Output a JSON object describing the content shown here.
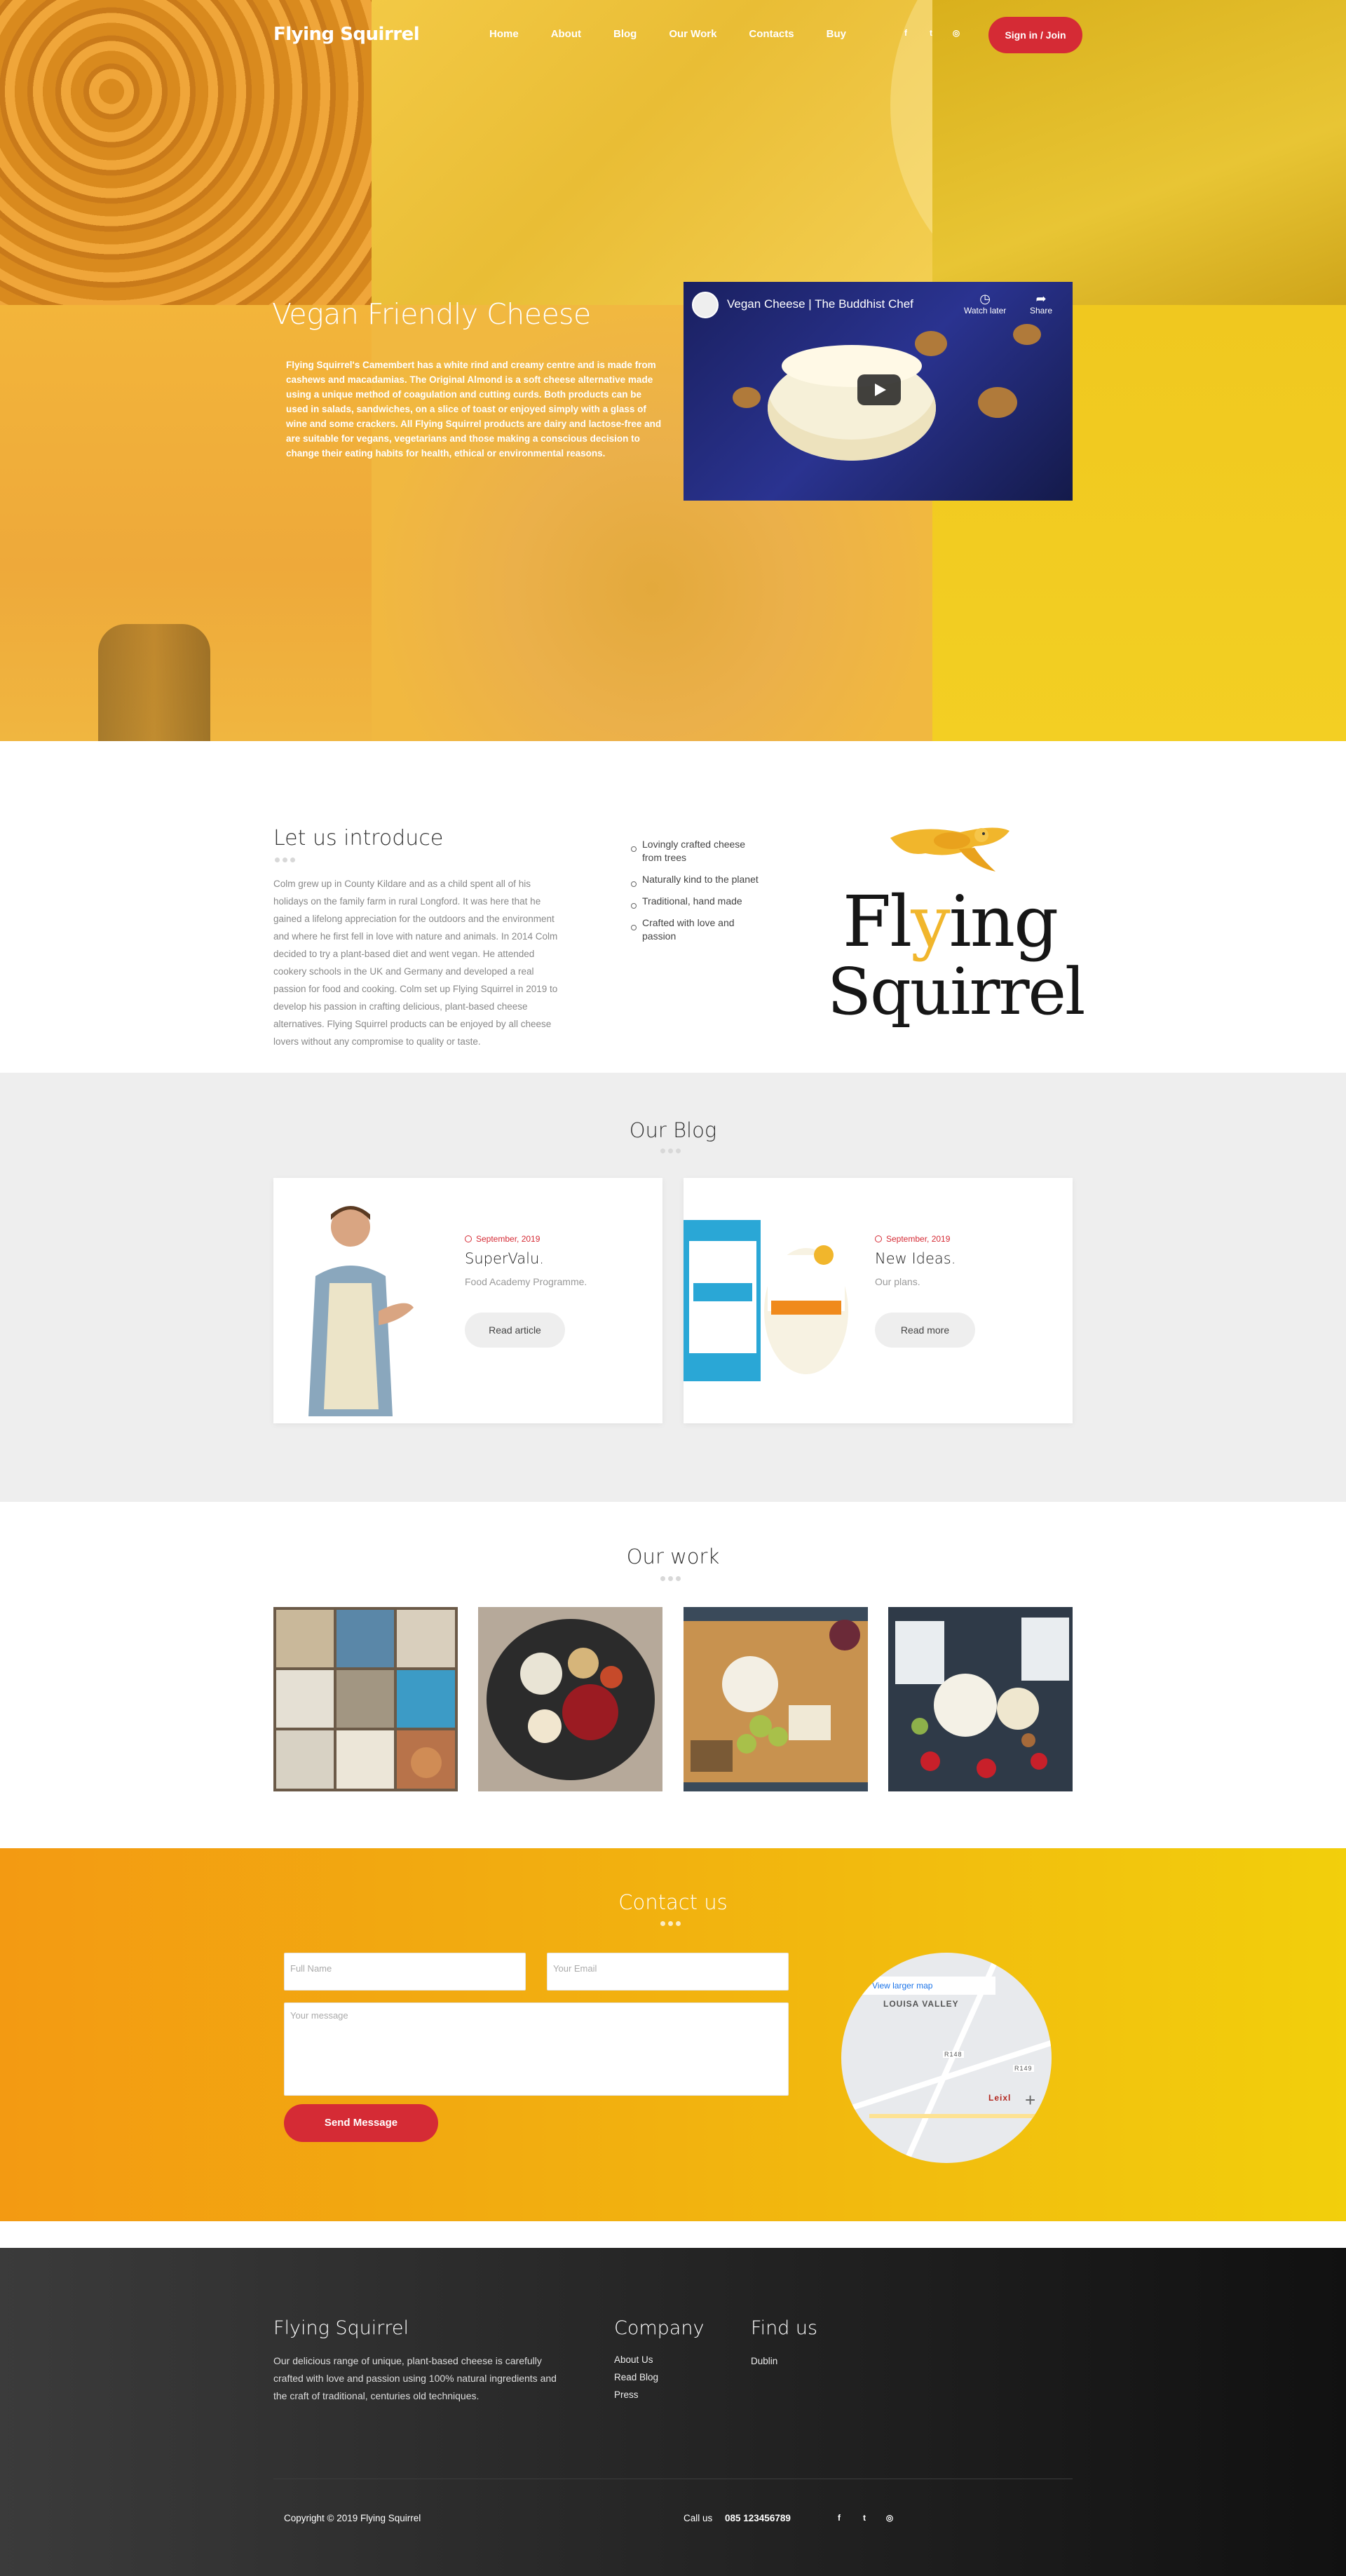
{
  "nav": {
    "brand": "Flying Squirrel",
    "menu": [
      "Home",
      "About",
      "Blog",
      "Our Work",
      "Contacts",
      "Buy"
    ],
    "social_icons": [
      "facebook-icon",
      "twitter-icon",
      "instagram-icon"
    ],
    "signin_label": "Sign in / Join"
  },
  "hero": {
    "title": "Vegan Friendly Cheese",
    "text": "Flying Squirrel's Camembert has a white rind and creamy centre and is made from cashews and macadamias. The Original Almond is a soft cheese alternative made using a unique method of coagulation and cutting curds. Both products can be used in salads, sandwiches, on a slice of toast or enjoyed simply with a glass of wine and some crackers. All Flying Squirrel products are dairy and lactose-free and are suitable for vegans, vegetarians and those making a conscious decision to change their eating habits for health, ethical or environmental reasons.",
    "video": {
      "title": "Vegan Cheese | The Buddhist Chef",
      "watch_later": "Watch later",
      "share": "Share"
    }
  },
  "intro": {
    "title": "Let us introduce",
    "text": "Colm grew up in County Kildare and as a child spent all of his holidays on the family farm in rural Longford. It was here that he gained a lifelong appreciation for the outdoors and the environment and where he first fell in love with nature and animals. In 2014 Colm decided to try a plant-based diet and went vegan. He attended cookery schools in the UK and Germany and developed a real passion for food and cooking. Colm set up Flying Squirrel in 2019 to develop his passion in crafting delicious, plant-based cheese alternatives. Flying Squirrel products can be enjoyed by all cheese lovers without any compromise to quality or taste.",
    "features": [
      "Lovingly crafted cheese from trees",
      "Naturally kind to the planet",
      "Traditional, hand made",
      "Crafted with love and passion"
    ],
    "logo_line1_a": "Fl",
    "logo_line1_b": "y",
    "logo_line1_c": "ing",
    "logo_line2": "Squirrel"
  },
  "blog": {
    "title": "Our Blog",
    "posts": [
      {
        "date": "September, 2019",
        "title": "SuperValu.",
        "subtitle": "Food Academy Programme.",
        "button": "Read article"
      },
      {
        "date": "September, 2019",
        "title": "New Ideas.",
        "subtitle": "Our plans.",
        "button": "Read more"
      }
    ]
  },
  "work": {
    "title": "Our work"
  },
  "contact": {
    "title": "Contact us",
    "name_placeholder": "Full Name",
    "email_placeholder": "Your Email",
    "message_placeholder": "Your message",
    "send_label": "Send Message",
    "map": {
      "larger_map": "View larger map",
      "area_label": "LOUISA VALLEY",
      "town_label": "Leixl",
      "road1": "R148",
      "road2": "R149"
    }
  },
  "footer": {
    "brand": "Flying Squirrel",
    "about_text": "Our delicious range of unique, plant-based cheese is carefully crafted with love and passion using 100% natural ingredients and the craft of traditional, centuries old techniques.",
    "company_title": "Company",
    "company_links": [
      "About Us",
      "Read Blog",
      "Press"
    ],
    "find_title": "Find us",
    "find_text": "Dublin",
    "copyright": "Copyright © 2019 Flying Squirrel",
    "call_label": "Call us",
    "phone": "085 123456789",
    "social_icons": [
      "facebook-icon",
      "twitter-icon",
      "instagram-icon"
    ]
  }
}
